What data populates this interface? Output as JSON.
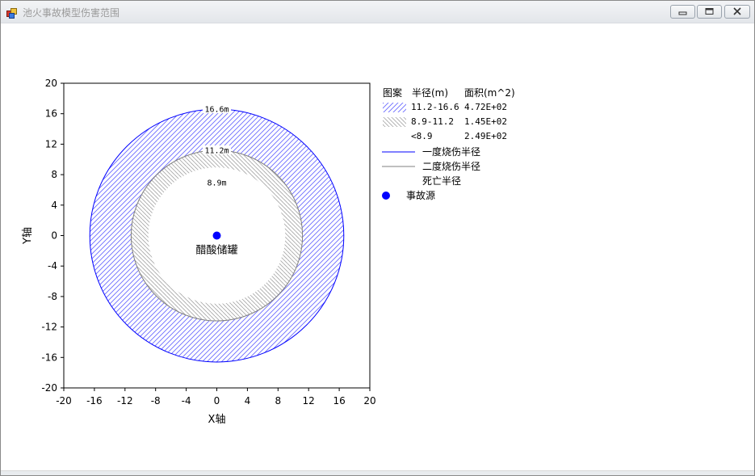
{
  "window": {
    "title": "池火事故模型伤害范围",
    "buttons": [
      "minimize",
      "maximize",
      "close"
    ]
  },
  "chart_data": {
    "type": "scatter",
    "xlabel": "X轴",
    "ylabel": "Y轴",
    "xlim": [
      -20,
      20
    ],
    "ylim": [
      -20,
      20
    ],
    "xticks": [
      -20,
      -16,
      -12,
      -8,
      -4,
      0,
      4,
      8,
      12,
      16,
      20
    ],
    "yticks": [
      -20,
      -16,
      -12,
      -8,
      -4,
      0,
      4,
      8,
      12,
      16,
      20
    ],
    "grid": false,
    "source": {
      "name": "醋酸储罐",
      "x": 0,
      "y": 0,
      "color": "#0000ff"
    },
    "circles": [
      {
        "label": "16.6m",
        "radius": 16.6,
        "color": "#0000ff",
        "type": "一度烧伤半径"
      },
      {
        "label": "11.2m",
        "radius": 11.2,
        "color": "#808080",
        "type": "二度烧伤半径"
      },
      {
        "label": "8.9m",
        "radius": 8.9,
        "color": "#ffffff",
        "type": "死亡半径"
      }
    ],
    "zones": [
      {
        "range": "11.2-16.6",
        "area": "4.72E+02",
        "hatch_color": "#6a6aff"
      },
      {
        "range": "8.9-11.2",
        "area": "1.45E+02",
        "hatch_color": "#a0a0a0"
      },
      {
        "range": "<8.9",
        "area": "2.49E+02",
        "hatch_color": "none"
      }
    ],
    "legend": {
      "placement": "right",
      "header": {
        "pattern": "图案",
        "radius": "半径(m)",
        "area": "面积(m^2)"
      },
      "line_items": [
        {
          "label": "一度烧伤半径",
          "color": "#0000ff"
        },
        {
          "label": "二度烧伤半径",
          "color": "#808080"
        },
        {
          "label": "死亡半径",
          "color": "#ffffff"
        }
      ],
      "source_item": {
        "label": "事故源",
        "color": "#0000ff"
      }
    }
  }
}
